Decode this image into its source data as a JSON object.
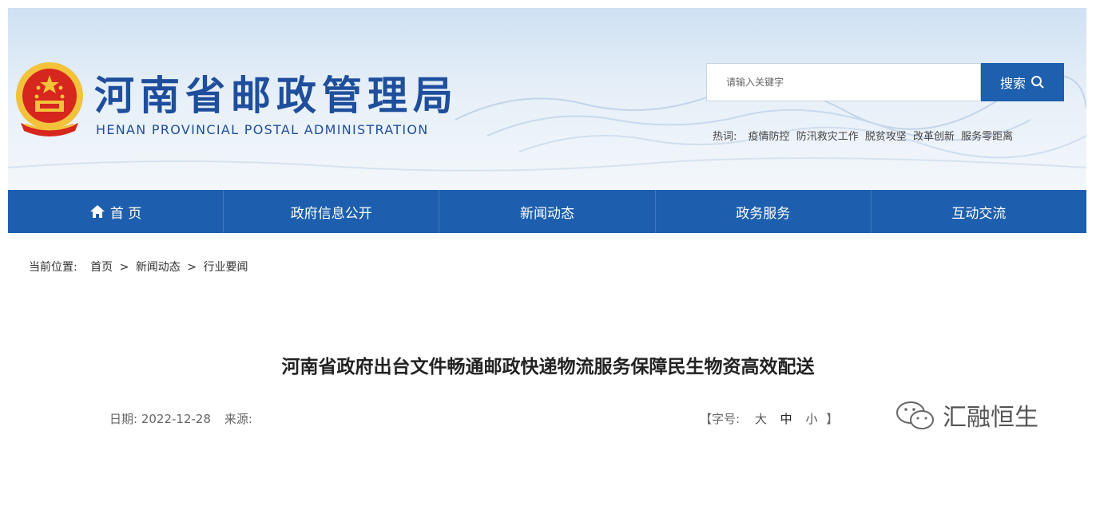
{
  "header": {
    "title_cn": "河南省邮政管理局",
    "title_en": "HENAN PROVINCIAL POSTAL ADMINISTRATION",
    "search": {
      "placeholder": "请输入关键字",
      "button_label": "搜索"
    },
    "hotwords": {
      "label": "热词:",
      "items": [
        "疫情防控",
        "防汛救灾工作",
        "脱贫攻坚",
        "改革创新",
        "服务零距离"
      ]
    }
  },
  "nav": {
    "items": [
      {
        "label": "首 页",
        "icon": "home-icon"
      },
      {
        "label": "政府信息公开"
      },
      {
        "label": "新闻动态"
      },
      {
        "label": "政务服务"
      },
      {
        "label": "互动交流"
      }
    ]
  },
  "breadcrumb": {
    "prefix": "当前位置:",
    "items": [
      "首页",
      ">",
      "新闻动态",
      ">",
      "行业要闻"
    ]
  },
  "article": {
    "title": "河南省政府出台文件畅通邮政快递物流服务保障民生物资高效配送",
    "date_label": "日期:",
    "date": "2022-12-28",
    "source_label": "来源:",
    "font_size": {
      "open": "【字号:",
      "large": "大",
      "medium": "中",
      "small": "小",
      "close": "】"
    }
  },
  "watermark": {
    "text": "汇融恒生",
    "icon": "wechat-icon"
  },
  "colors": {
    "brand_blue": "#1e5fae",
    "title_blue": "#1e4e9c",
    "emblem_red": "#d7261e",
    "emblem_gold": "#f3c23b"
  }
}
